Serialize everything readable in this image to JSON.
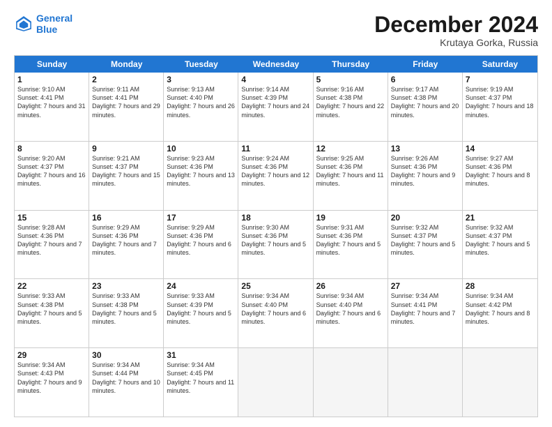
{
  "header": {
    "logo_line1": "General",
    "logo_line2": "Blue",
    "month": "December 2024",
    "location": "Krutaya Gorka, Russia"
  },
  "weekdays": [
    "Sunday",
    "Monday",
    "Tuesday",
    "Wednesday",
    "Thursday",
    "Friday",
    "Saturday"
  ],
  "rows": [
    [
      {
        "day": "1",
        "rise": "Sunrise: 9:10 AM",
        "set": "Sunset: 4:41 PM",
        "day_info": "Daylight: 7 hours and 31 minutes."
      },
      {
        "day": "2",
        "rise": "Sunrise: 9:11 AM",
        "set": "Sunset: 4:41 PM",
        "day_info": "Daylight: 7 hours and 29 minutes."
      },
      {
        "day": "3",
        "rise": "Sunrise: 9:13 AM",
        "set": "Sunset: 4:40 PM",
        "day_info": "Daylight: 7 hours and 26 minutes."
      },
      {
        "day": "4",
        "rise": "Sunrise: 9:14 AM",
        "set": "Sunset: 4:39 PM",
        "day_info": "Daylight: 7 hours and 24 minutes."
      },
      {
        "day": "5",
        "rise": "Sunrise: 9:16 AM",
        "set": "Sunset: 4:38 PM",
        "day_info": "Daylight: 7 hours and 22 minutes."
      },
      {
        "day": "6",
        "rise": "Sunrise: 9:17 AM",
        "set": "Sunset: 4:38 PM",
        "day_info": "Daylight: 7 hours and 20 minutes."
      },
      {
        "day": "7",
        "rise": "Sunrise: 9:19 AM",
        "set": "Sunset: 4:37 PM",
        "day_info": "Daylight: 7 hours and 18 minutes."
      }
    ],
    [
      {
        "day": "8",
        "rise": "Sunrise: 9:20 AM",
        "set": "Sunset: 4:37 PM",
        "day_info": "Daylight: 7 hours and 16 minutes."
      },
      {
        "day": "9",
        "rise": "Sunrise: 9:21 AM",
        "set": "Sunset: 4:37 PM",
        "day_info": "Daylight: 7 hours and 15 minutes."
      },
      {
        "day": "10",
        "rise": "Sunrise: 9:23 AM",
        "set": "Sunset: 4:36 PM",
        "day_info": "Daylight: 7 hours and 13 minutes."
      },
      {
        "day": "11",
        "rise": "Sunrise: 9:24 AM",
        "set": "Sunset: 4:36 PM",
        "day_info": "Daylight: 7 hours and 12 minutes."
      },
      {
        "day": "12",
        "rise": "Sunrise: 9:25 AM",
        "set": "Sunset: 4:36 PM",
        "day_info": "Daylight: 7 hours and 11 minutes."
      },
      {
        "day": "13",
        "rise": "Sunrise: 9:26 AM",
        "set": "Sunset: 4:36 PM",
        "day_info": "Daylight: 7 hours and 9 minutes."
      },
      {
        "day": "14",
        "rise": "Sunrise: 9:27 AM",
        "set": "Sunset: 4:36 PM",
        "day_info": "Daylight: 7 hours and 8 minutes."
      }
    ],
    [
      {
        "day": "15",
        "rise": "Sunrise: 9:28 AM",
        "set": "Sunset: 4:36 PM",
        "day_info": "Daylight: 7 hours and 7 minutes."
      },
      {
        "day": "16",
        "rise": "Sunrise: 9:29 AM",
        "set": "Sunset: 4:36 PM",
        "day_info": "Daylight: 7 hours and 7 minutes."
      },
      {
        "day": "17",
        "rise": "Sunrise: 9:29 AM",
        "set": "Sunset: 4:36 PM",
        "day_info": "Daylight: 7 hours and 6 minutes."
      },
      {
        "day": "18",
        "rise": "Sunrise: 9:30 AM",
        "set": "Sunset: 4:36 PM",
        "day_info": "Daylight: 7 hours and 5 minutes."
      },
      {
        "day": "19",
        "rise": "Sunrise: 9:31 AM",
        "set": "Sunset: 4:36 PM",
        "day_info": "Daylight: 7 hours and 5 minutes."
      },
      {
        "day": "20",
        "rise": "Sunrise: 9:32 AM",
        "set": "Sunset: 4:37 PM",
        "day_info": "Daylight: 7 hours and 5 minutes."
      },
      {
        "day": "21",
        "rise": "Sunrise: 9:32 AM",
        "set": "Sunset: 4:37 PM",
        "day_info": "Daylight: 7 hours and 5 minutes."
      }
    ],
    [
      {
        "day": "22",
        "rise": "Sunrise: 9:33 AM",
        "set": "Sunset: 4:38 PM",
        "day_info": "Daylight: 7 hours and 5 minutes."
      },
      {
        "day": "23",
        "rise": "Sunrise: 9:33 AM",
        "set": "Sunset: 4:38 PM",
        "day_info": "Daylight: 7 hours and 5 minutes."
      },
      {
        "day": "24",
        "rise": "Sunrise: 9:33 AM",
        "set": "Sunset: 4:39 PM",
        "day_info": "Daylight: 7 hours and 5 minutes."
      },
      {
        "day": "25",
        "rise": "Sunrise: 9:34 AM",
        "set": "Sunset: 4:40 PM",
        "day_info": "Daylight: 7 hours and 6 minutes."
      },
      {
        "day": "26",
        "rise": "Sunrise: 9:34 AM",
        "set": "Sunset: 4:40 PM",
        "day_info": "Daylight: 7 hours and 6 minutes."
      },
      {
        "day": "27",
        "rise": "Sunrise: 9:34 AM",
        "set": "Sunset: 4:41 PM",
        "day_info": "Daylight: 7 hours and 7 minutes."
      },
      {
        "day": "28",
        "rise": "Sunrise: 9:34 AM",
        "set": "Sunset: 4:42 PM",
        "day_info": "Daylight: 7 hours and 8 minutes."
      }
    ],
    [
      {
        "day": "29",
        "rise": "Sunrise: 9:34 AM",
        "set": "Sunset: 4:43 PM",
        "day_info": "Daylight: 7 hours and 9 minutes."
      },
      {
        "day": "30",
        "rise": "Sunrise: 9:34 AM",
        "set": "Sunset: 4:44 PM",
        "day_info": "Daylight: 7 hours and 10 minutes."
      },
      {
        "day": "31",
        "rise": "Sunrise: 9:34 AM",
        "set": "Sunset: 4:45 PM",
        "day_info": "Daylight: 7 hours and 11 minutes."
      },
      null,
      null,
      null,
      null
    ]
  ]
}
